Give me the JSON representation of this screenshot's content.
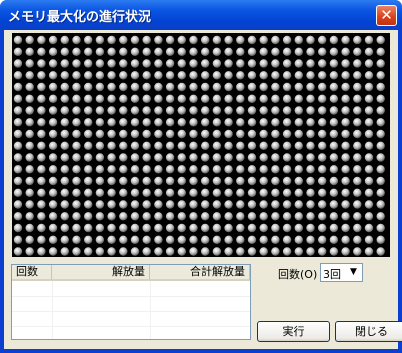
{
  "window": {
    "title": "メモリ最大化の進行状況",
    "close_glyph": "✕"
  },
  "memory_map": {
    "dot_color": "#c0c0c0",
    "background": "#000000"
  },
  "results_table": {
    "columns": [
      "回数",
      "解放量",
      "合計解放量"
    ],
    "rows": []
  },
  "count": {
    "label": "回数(O)",
    "value": "3回",
    "arrow": "▼"
  },
  "buttons": {
    "run": "実行",
    "close": "閉じる"
  }
}
